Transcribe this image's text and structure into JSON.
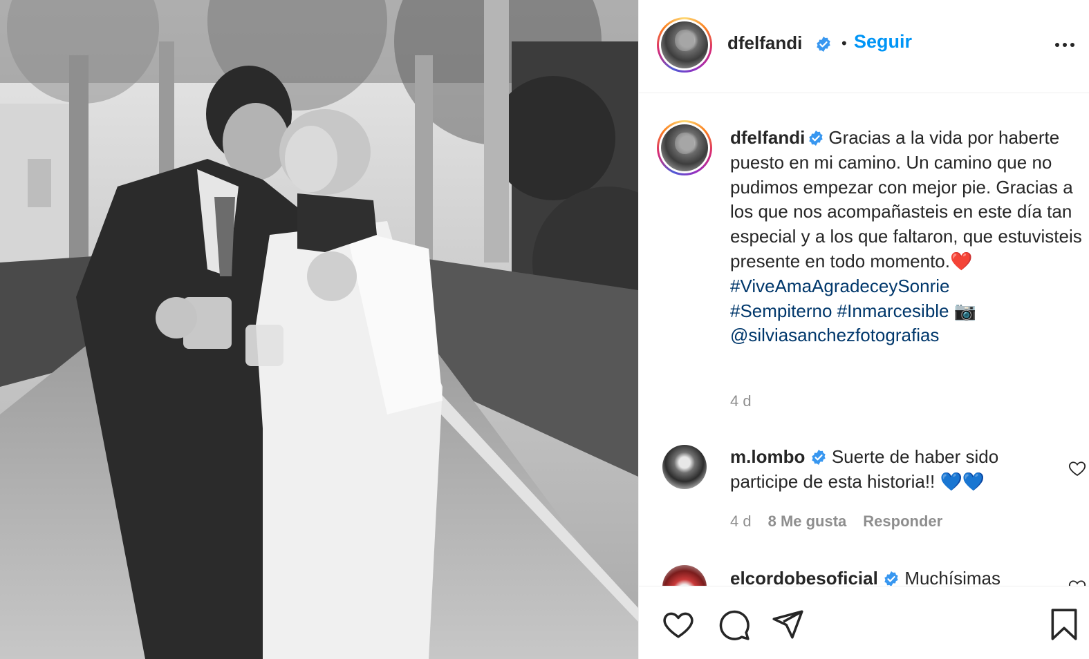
{
  "post": {
    "author": "dfelfandi",
    "follow_label": "Seguir",
    "separator": "•"
  },
  "caption": {
    "username": "dfelfandi",
    "text_plain": "Gracias a la vida por haberte puesto en mi camino. Un camino que no pudimos empezar con mejor pie. Gracias a los que nos acompañasteis en este día tan especial y a los que faltaron, que estuvisteis presente en todo momento.",
    "heart_emoji": "❤️",
    "hashtag_1": "#ViveAmaAgradeceySonrie",
    "hashtag_2": "#Sempiterno",
    "hashtag_3": "#Inmarcesible",
    "camera_emoji": "📷",
    "mention": "@silviasanchezfotografias",
    "time": "4 d"
  },
  "comments": [
    {
      "username": "m.lombo",
      "text": "Suerte de haber sido participe de esta historia!!",
      "emoji": "💙💙",
      "time": "4 d",
      "likes": "8 Me gusta",
      "reply_label": "Responder"
    },
    {
      "username": "elcordobesoficial",
      "text": "Muchísimas"
    }
  ],
  "icons": {
    "verified": "verified-badge-icon",
    "more": "more-options-icon",
    "like": "heart-icon",
    "comment": "comment-bubble-icon",
    "share": "paper-plane-icon",
    "save": "bookmark-icon"
  },
  "colors": {
    "follow_blue": "#0095f6",
    "hashtag": "#00376b",
    "meta_gray": "#8e8e8e",
    "verified_blue": "#3897f0"
  }
}
